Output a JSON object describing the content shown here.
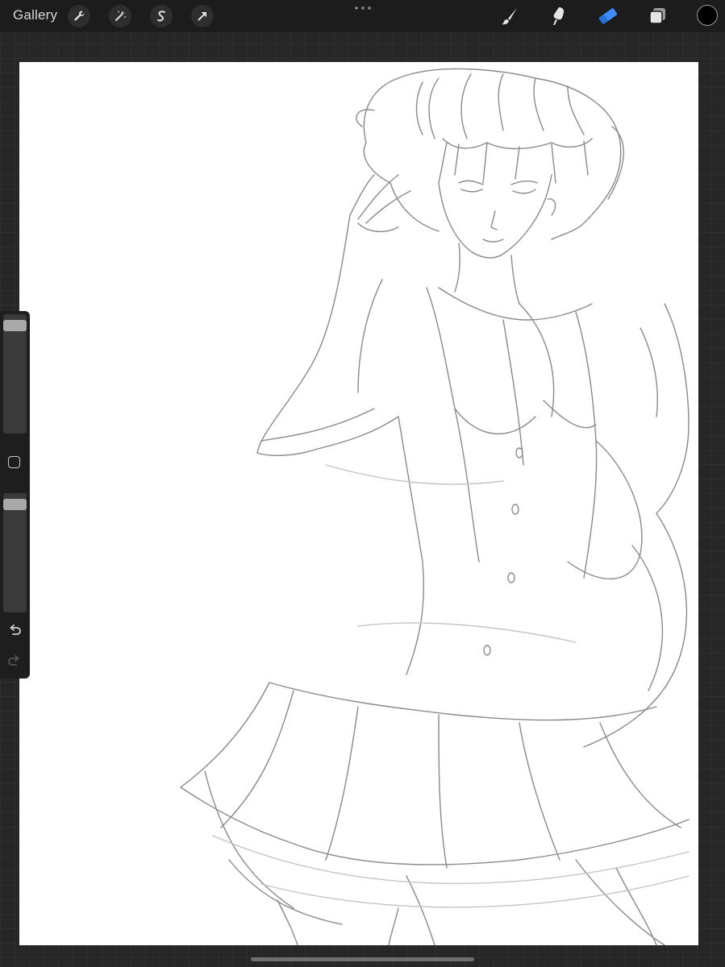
{
  "toolbar": {
    "gallery_label": "Gallery",
    "left_tools": [
      "wrench-icon",
      "magic-wand-icon",
      "selection-s-icon",
      "transform-arrow-icon"
    ],
    "right_tools": [
      "brush-icon",
      "smudge-icon",
      "eraser-icon",
      "layers-icon"
    ],
    "active_tool": "eraser-icon",
    "accent_color": "#3d8bff",
    "current_color": "#000000"
  },
  "sidebar": {
    "brush_size_level": 0.95,
    "opacity_level": 0.95,
    "icons": [
      "modify-square-icon",
      "undo-icon",
      "redo-icon"
    ]
  },
  "canvas": {
    "background": "#ffffff",
    "stroke_color": "#8a8a8a"
  }
}
